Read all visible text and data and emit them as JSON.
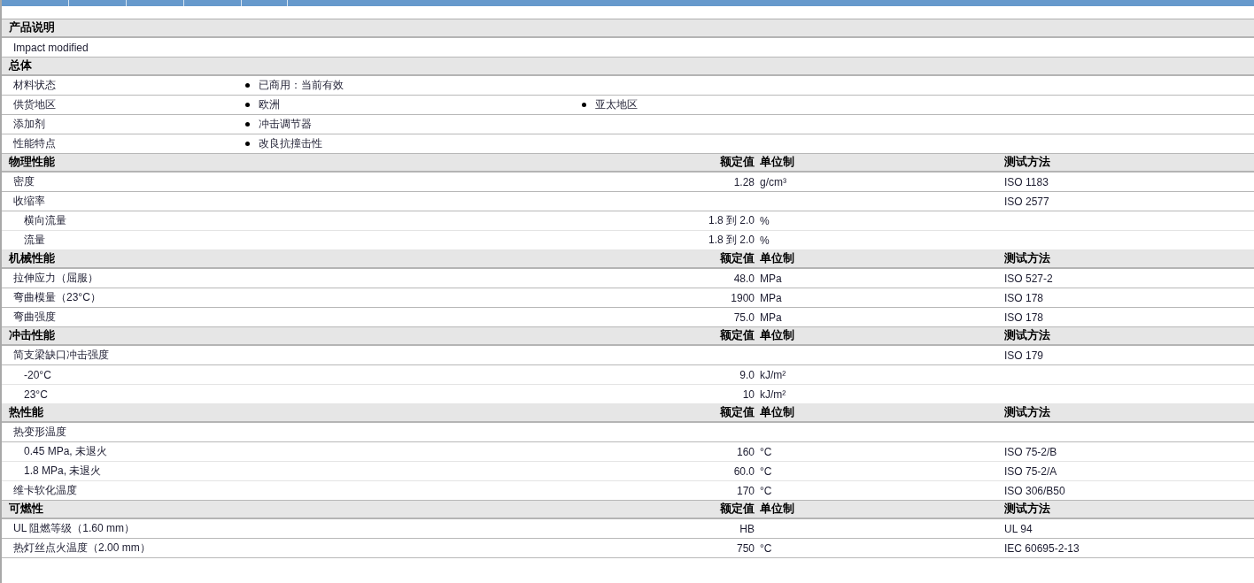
{
  "sections": [
    {
      "kind": "text",
      "title": "产品说明",
      "rows": [
        {
          "text": "Impact modified"
        }
      ]
    },
    {
      "kind": "list",
      "title": "总体",
      "rows": [
        {
          "label": "材料状态",
          "items": [
            "已商用：当前有效"
          ]
        },
        {
          "label": "供货地区",
          "items": [
            "欧洲",
            "亚太地区"
          ]
        },
        {
          "label": "添加剂",
          "items": [
            "冲击调节器"
          ]
        },
        {
          "label": "性能特点",
          "items": [
            "改良抗撞击性"
          ]
        }
      ]
    },
    {
      "kind": "props",
      "title": "物理性能",
      "headers": {
        "value": "额定值",
        "unit": "单位制",
        "method": "测试方法"
      },
      "rows": [
        {
          "label": "密度",
          "value": "1.28",
          "unit": "g/cm³",
          "method": "ISO 1183"
        },
        {
          "label": "收缩率",
          "method": "ISO 2577",
          "children": [
            {
              "label": "横向流量",
              "value": "1.8 到  2.0",
              "unit": "%"
            },
            {
              "label": "流量",
              "value": "1.8 到  2.0",
              "unit": "%"
            }
          ]
        }
      ]
    },
    {
      "kind": "props",
      "title": "机械性能",
      "headers": {
        "value": "额定值",
        "unit": "单位制",
        "method": "测试方法"
      },
      "rows": [
        {
          "label": "拉伸应力（屈服）",
          "value": "48.0",
          "unit": "MPa",
          "method": "ISO 527-2"
        },
        {
          "label": "弯曲模量（23°C）",
          "value": "1900",
          "unit": "MPa",
          "method": "ISO 178"
        },
        {
          "label": "弯曲强度",
          "value": "75.0",
          "unit": "MPa",
          "method": "ISO 178"
        }
      ]
    },
    {
      "kind": "props",
      "title": "冲击性能",
      "headers": {
        "value": "额定值",
        "unit": "单位制",
        "method": "测试方法"
      },
      "rows": [
        {
          "label": "简支梁缺口冲击强度",
          "method": "ISO 179",
          "children": [
            {
              "label": "-20°C",
              "value": "9.0",
              "unit": "kJ/m²"
            },
            {
              "label": "23°C",
              "value": "10",
              "unit": "kJ/m²"
            }
          ]
        }
      ]
    },
    {
      "kind": "props",
      "title": "热性能",
      "headers": {
        "value": "额定值",
        "unit": "单位制",
        "method": "测试方法"
      },
      "rows": [
        {
          "label": "热变形温度",
          "children": [
            {
              "label": "0.45 MPa, 未退火",
              "value": "160",
              "unit": "°C",
              "method": "ISO 75-2/B"
            },
            {
              "label": "1.8 MPa, 未退火",
              "value": "60.0",
              "unit": "°C",
              "method": "ISO 75-2/A"
            }
          ]
        },
        {
          "label": "维卡软化温度",
          "value": "170",
          "unit": "°C",
          "method": "ISO 306/B50"
        }
      ]
    },
    {
      "kind": "props",
      "title": "可燃性",
      "headers": {
        "value": "额定值",
        "unit": "单位制",
        "method": "测试方法"
      },
      "rows": [
        {
          "label": "UL 阻燃等级（1.60 mm）",
          "value": "HB",
          "method": "UL 94"
        },
        {
          "label": "热灯丝点火温度（2.00 mm）",
          "value": "750",
          "unit": "°C",
          "method": "IEC 60695-2-13"
        }
      ]
    }
  ]
}
